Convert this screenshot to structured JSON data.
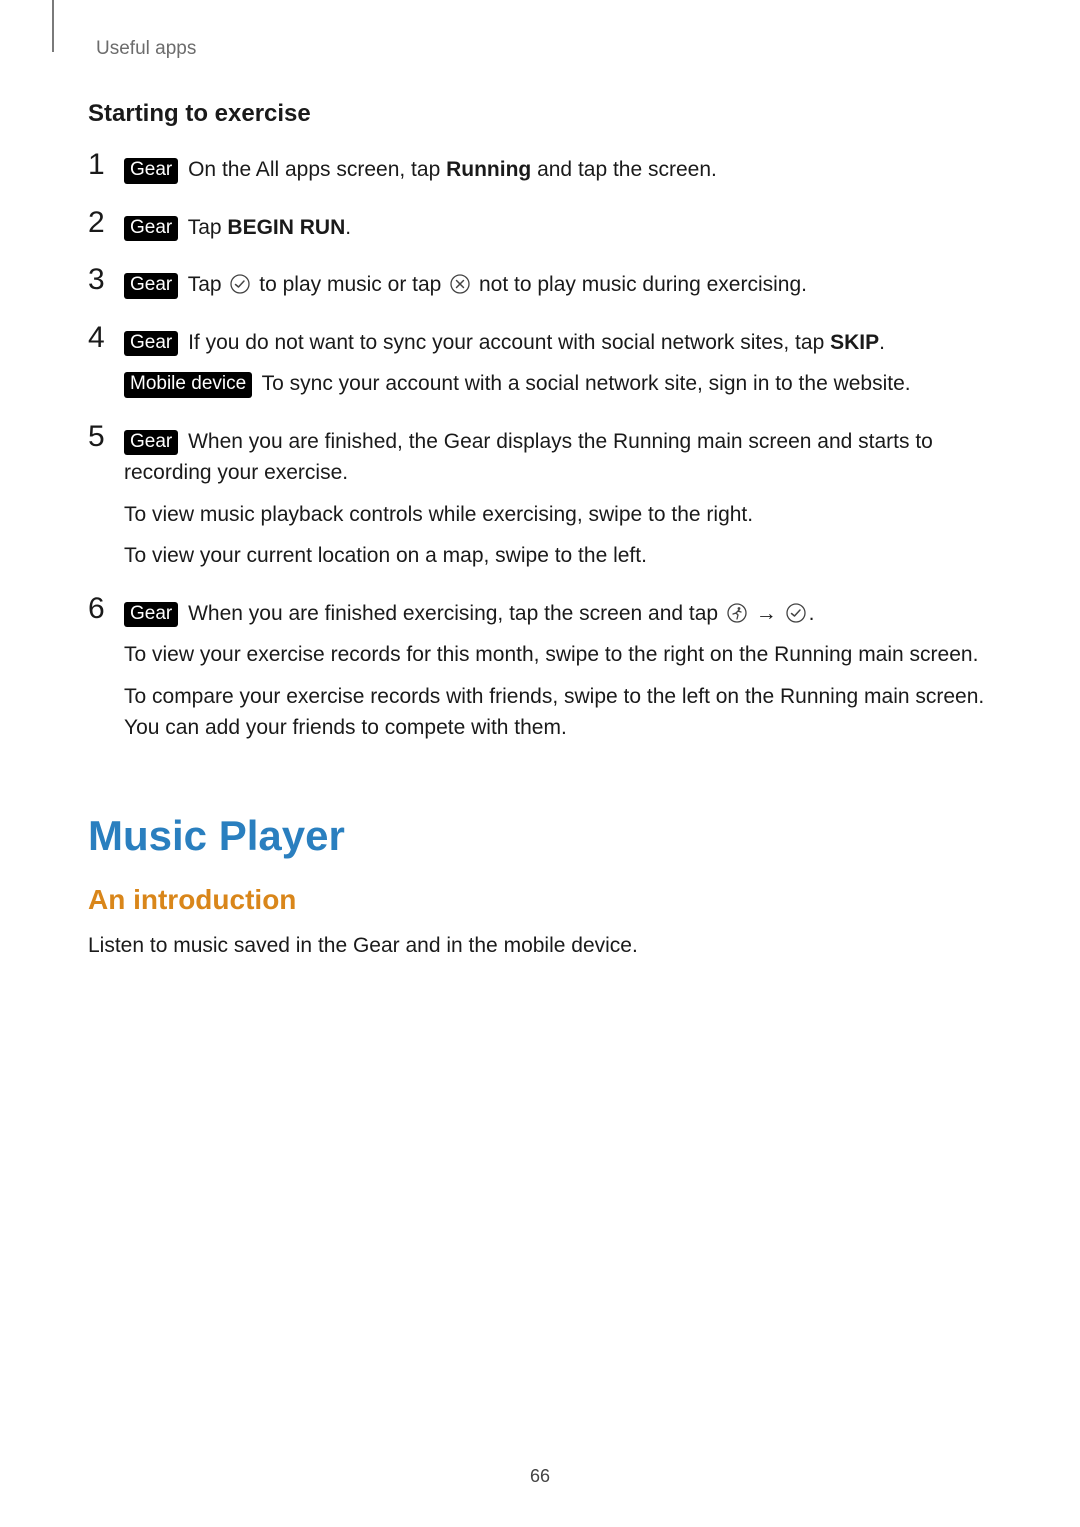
{
  "header": {
    "running": "Useful apps"
  },
  "section": {
    "title": "Starting to exercise"
  },
  "labels": {
    "gear": "Gear",
    "mobile": "Mobile device",
    "arrow": "→"
  },
  "steps": [
    {
      "num": "1",
      "lines": [
        {
          "pill": "gear",
          "pre": "On the All apps screen, tap ",
          "bold": "Running",
          "post": " and tap the screen."
        }
      ]
    },
    {
      "num": "2",
      "lines": [
        {
          "pill": "gear",
          "pre": "Tap ",
          "bold": "BEGIN RUN",
          "post": "."
        }
      ]
    },
    {
      "num": "3",
      "lines": [
        {
          "pill": "gear",
          "pre": "Tap ",
          "icon1": "check",
          "mid": " to play music or tap ",
          "icon2": "cross",
          "post": " not to play music during exercising."
        }
      ]
    },
    {
      "num": "4",
      "lines": [
        {
          "pill": "gear",
          "pre": "If you do not want to sync your account with social network sites, tap ",
          "bold": "SKIP",
          "post": "."
        },
        {
          "pill": "mobile",
          "pre": "To sync your account with a social network site, sign in to the website."
        }
      ]
    },
    {
      "num": "5",
      "lines": [
        {
          "pill": "gear",
          "pre": "When you are finished, the Gear displays the Running main screen and starts to recording your exercise."
        },
        {
          "plain": "To view music playback controls while exercising, swipe to the right."
        },
        {
          "plain": "To view your current location on a map, swipe to the left."
        }
      ]
    },
    {
      "num": "6",
      "lines": [
        {
          "pill": "gear",
          "pre": "When you are finished exercising, tap the screen and tap ",
          "icon1": "runner",
          "arrow": true,
          "icon2": "check",
          "post": "."
        },
        {
          "plain": "To view your exercise records for this month, swipe to the right on the Running main screen."
        },
        {
          "plain": "To compare your exercise records with friends, swipe to the left on the Running main screen. You can add your friends to compete with them."
        }
      ]
    }
  ],
  "music": {
    "title": "Music Player",
    "subtitle": "An introduction",
    "body": "Listen to music saved in the Gear and in the mobile device."
  },
  "page_number": "66"
}
